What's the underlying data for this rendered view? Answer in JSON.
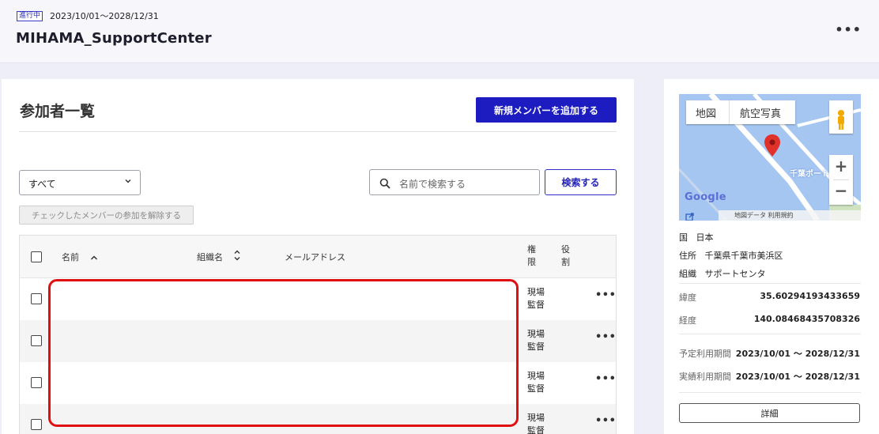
{
  "header": {
    "status_badge": "進行中",
    "period": "2023/10/01〜2028/12/31",
    "project_name": "MIHAMA_SupportCenter",
    "more_label": "•••"
  },
  "participants": {
    "title": "参加者一覧",
    "add_member_label": "新規メンバーを追加する",
    "filter_value": "すべて",
    "search_placeholder": "名前で検索する",
    "search_button_label": "検索する",
    "release_button_label": "チェックしたメンバーの参加を解除する",
    "columns": {
      "name": "名前",
      "organization": "組織名",
      "email": "メールアドレス",
      "authority": [
        "権",
        "限"
      ],
      "role": [
        "役",
        "割"
      ]
    },
    "rows": [
      {
        "role": [
          "現場",
          "監督"
        ]
      },
      {
        "role": [
          "現場",
          "監督"
        ]
      },
      {
        "role": [
          "現場",
          "監督"
        ]
      },
      {
        "role": [
          "現場",
          "監督"
        ]
      }
    ],
    "row_more_label": "•••"
  },
  "map": {
    "tab_map": "地図",
    "tab_satellite": "航空写真",
    "place_label": "千葉ポート",
    "google_label": "Google",
    "footer_label": "地図データ  利用規約",
    "zoom_in": "+",
    "zoom_out": "−"
  },
  "location": {
    "country_label": "国",
    "country_value": "日本",
    "address_label": "住所",
    "address_value": "千葉県千葉市美浜区",
    "organization_label": "組織",
    "organization_value": "サポートセンタ",
    "latitude_label": "緯度",
    "latitude_value": "35.60294193433659",
    "longitude_label": "経度",
    "longitude_value": "140.08468435708326",
    "planned_period_label": "予定利用期間",
    "planned_period_value": "2023/10/01 ～ 2028/12/31",
    "actual_period_label": "実績利用期間",
    "actual_period_value": "2023/10/01 ～ 2028/12/31",
    "detail_button_label": "詳細"
  },
  "colors": {
    "primary": "#1c1cc0",
    "highlight": "#e01010",
    "map_water": "#a6c6f2"
  }
}
